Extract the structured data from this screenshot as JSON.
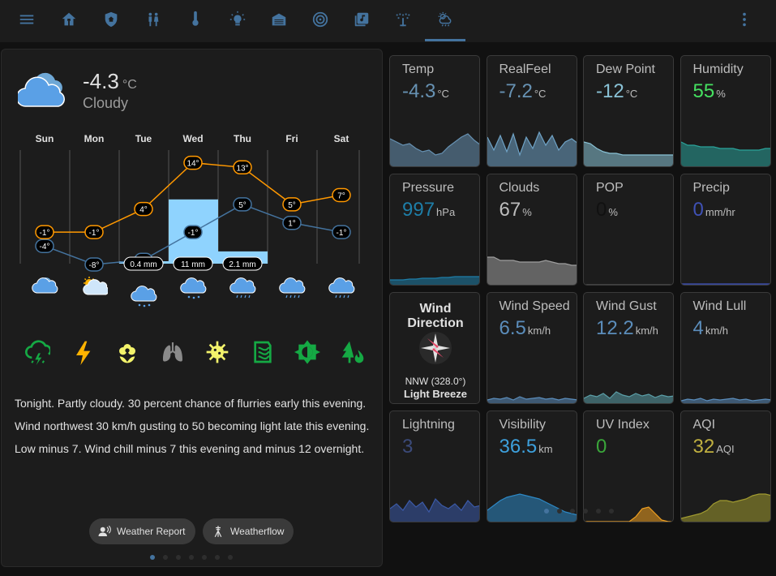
{
  "topbar": {
    "items": [
      "menu-icon",
      "home-icon",
      "shield-icon",
      "people-icon",
      "thermometer-icon",
      "lightbulb-icon",
      "garage-icon",
      "speaker-icon",
      "music-library-icon",
      "sprinkler-icon",
      "weather-icon"
    ],
    "more": "more-vertical-icon",
    "active_index": 10,
    "accent": "#44739e"
  },
  "current": {
    "temp": "-4.3",
    "unit": "°C",
    "condition": "Cloudy"
  },
  "forecast": {
    "days": [
      "Sun",
      "Mon",
      "Tue",
      "Wed",
      "Thu",
      "Fri",
      "Sat"
    ],
    "highs": [
      "-1°",
      "-1°",
      "4°",
      "14°",
      "13°",
      "5°",
      "7°"
    ],
    "lows": [
      "-4°",
      "-8°",
      "-7°",
      "-1°",
      "5°",
      "1°",
      "-1°"
    ],
    "high_values": [
      -1,
      -1,
      4,
      14,
      13,
      5,
      7
    ],
    "low_values": [
      -4,
      -8,
      -7,
      -1,
      5,
      1,
      -1
    ],
    "precip": [
      "",
      "",
      "0.4 mm",
      "11 mm",
      "2.1 mm",
      "",
      ""
    ],
    "precip_values": [
      0,
      0,
      0.4,
      11,
      2.1,
      0,
      0
    ],
    "icons": [
      "cloudy-icon",
      "partly-cloudy-icon",
      "snow-icon",
      "snow-icon",
      "rain-icon",
      "rain-icon",
      "rain-icon"
    ],
    "high_color": "#ff9800",
    "low_color": "#44739e",
    "precip_color": "#8fd3fe"
  },
  "pollen_icons": [
    {
      "name": "thunderstorm-icon",
      "color": "#15a944"
    },
    {
      "name": "lightning-icon",
      "color": "#ffb300"
    },
    {
      "name": "flower-icon",
      "color": "#f3f36b"
    },
    {
      "name": "lungs-icon",
      "color": "#8a8a8a"
    },
    {
      "name": "virus-icon",
      "color": "#f3f36b"
    },
    {
      "name": "air-filter-icon",
      "color": "#15a944"
    },
    {
      "name": "brightness-icon",
      "color": "#15a944"
    },
    {
      "name": "tree-fire-icon",
      "color": "#15a944"
    }
  ],
  "forecast_text": "Tonight. Partly cloudy. 30 percent chance of flurries early this evening. Wind northwest 30 km/h gusting to 50 becoming light late this evening. Low minus 7. Wind chill minus 7 this evening and minus 12 overnight.",
  "chips": [
    {
      "label": "Weather Report",
      "icon": "account-voice-icon"
    },
    {
      "label": "Weatherflow",
      "icon": "weather-station-icon"
    }
  ],
  "tiles": [
    {
      "name": "Temp",
      "value": "-4.3",
      "unit": "°C",
      "color": "#6792b3",
      "spark": "#6792b3"
    },
    {
      "name": "RealFeel",
      "value": "-7.2",
      "unit": "°C",
      "color": "#6792b3",
      "spark": "#6fa3c6"
    },
    {
      "name": "Dew Point",
      "value": "-12",
      "unit": "°C",
      "color": "#89c2d6",
      "spark": "#89c2d6"
    },
    {
      "name": "Humidity",
      "value": "55",
      "unit": "%",
      "color": "#45e060",
      "spark": "#2aa39a"
    },
    {
      "name": "Pressure",
      "value": "997",
      "unit": "hPa",
      "color": "#1e7ea8",
      "spark": "#1e7ea8"
    },
    {
      "name": "Clouds",
      "value": "67",
      "unit": "%",
      "color": "#bdbdbd",
      "spark": "#9e9e9e"
    },
    {
      "name": "POP",
      "value": "0",
      "unit": "%",
      "color": "#111111",
      "spark": "#555555"
    },
    {
      "name": "Precip",
      "value": "0",
      "unit": "mm/hr",
      "color": "#3f51b5",
      "spark": "#3f51b5"
    },
    {
      "name": "Wind Direction",
      "value": "",
      "unit": "",
      "direction": "NNW (328.0°)",
      "description": "Light Breeze"
    },
    {
      "name": "Wind Speed",
      "value": "6.5",
      "unit": "km/h",
      "color": "#5b8dbb",
      "spark": "#5b8dbb"
    },
    {
      "name": "Wind Gust",
      "value": "12.2",
      "unit": "km/h",
      "color": "#5b8dbb",
      "spark": "#5b9fa8"
    },
    {
      "name": "Wind Lull",
      "value": "4",
      "unit": "km/h",
      "color": "#5b8dbb",
      "spark": "#5b8dbb"
    },
    {
      "name": "Lightning",
      "value": "3",
      "unit": "",
      "color": "#3b4a7a",
      "spark": "#3b5aa8"
    },
    {
      "name": "Visibility",
      "value": "36.5",
      "unit": "km",
      "color": "#3da0dc",
      "spark": "#2d88c5"
    },
    {
      "name": "UV Index",
      "value": "0",
      "unit": "",
      "color": "#3aa63a",
      "spark": "#f0a020"
    },
    {
      "name": "AQI",
      "value": "32",
      "unit": "AQI",
      "color": "#c0b040",
      "spark": "#a09a30"
    }
  ]
}
